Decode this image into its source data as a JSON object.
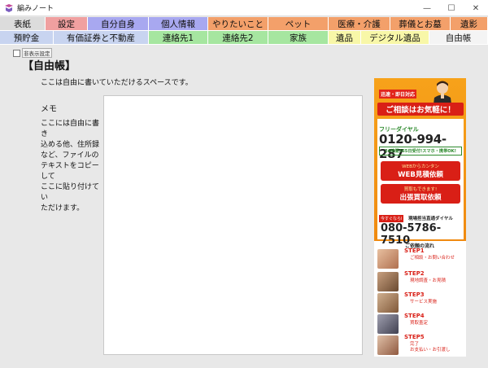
{
  "window": {
    "title": "編みノート",
    "controls": [
      "—",
      "☐",
      "✕"
    ]
  },
  "tabs_row1": [
    {
      "label": "表紙",
      "color": "#dcdcdc"
    },
    {
      "label": "設定",
      "color": "#f0a0a0"
    },
    {
      "label": "自分自身",
      "color": "#a8a8f0"
    },
    {
      "label": "個人情報",
      "color": "#a8a8f0"
    },
    {
      "label": "やりたいこと",
      "color": "#f3a06a"
    },
    {
      "label": "ペット",
      "color": "#f3a06a"
    },
    {
      "label": "医療・介護",
      "color": "#f3a06a"
    },
    {
      "label": "葬儀とお墓",
      "color": "#f3a06a"
    },
    {
      "label": "遺影",
      "color": "#f3a06a"
    }
  ],
  "tabs_row2": [
    {
      "label": "預貯金",
      "color": "#c8d4f0"
    },
    {
      "label": "有価証券と不動産",
      "color": "#c8d4f0"
    },
    {
      "label": "連絡先1",
      "color": "#a6e6a0"
    },
    {
      "label": "連絡先2",
      "color": "#a6e6a0"
    },
    {
      "label": "家族",
      "color": "#a6e6a0"
    },
    {
      "label": "遺品",
      "color": "#f8f7a8"
    },
    {
      "label": "デジタル遺品",
      "color": "#f8f7a8"
    },
    {
      "label": "自由帳",
      "color": "#f4f4f4"
    }
  ],
  "option": {
    "label": "非表示設定",
    "checked": false
  },
  "page": {
    "heading": "【自由帳】",
    "description": "ここは自由に書いていただけるスペースです。",
    "memo_label": "メモ",
    "memo_help": [
      "ここには自由に書き",
      "込める他、住所録",
      "など、ファイルの",
      "テキストをコピーして",
      "ここに貼り付けてい",
      "ただけます。"
    ],
    "memo_value": ""
  },
  "ad": {
    "tag": "迅速・即日対応",
    "headline": "ご相談はお気軽に！",
    "freedial_label": "フリーダイヤル",
    "freedial_number": "0120-994-287",
    "hours": "24時間365日受付!スマホ・携帯OK!",
    "web_small": "WEBからカンタン",
    "web_big": "WEB見積依頼",
    "visit_small": "買取もできます!",
    "visit_big": "出張買取依頼",
    "now_tag": "今すぐならI",
    "direct_label": "現場担当直通ダイヤル",
    "direct_number": "080-5786-7510",
    "flow_title": "ご依頼の流れ",
    "steps": [
      {
        "name": "STEP1",
        "desc": "ご相談・お問い合わせ"
      },
      {
        "name": "STEP2",
        "desc": "現地調査・お見積"
      },
      {
        "name": "STEP3",
        "desc": "サービス実施"
      },
      {
        "name": "STEP4",
        "desc": "買取査定"
      },
      {
        "name": "STEP5",
        "desc": "完了\nお支払い・お引渡し"
      }
    ]
  },
  "colors": {
    "accent_red": "#d91f16",
    "ad_orange": "#f4951a",
    "ad_green": "#2d8a2d"
  }
}
